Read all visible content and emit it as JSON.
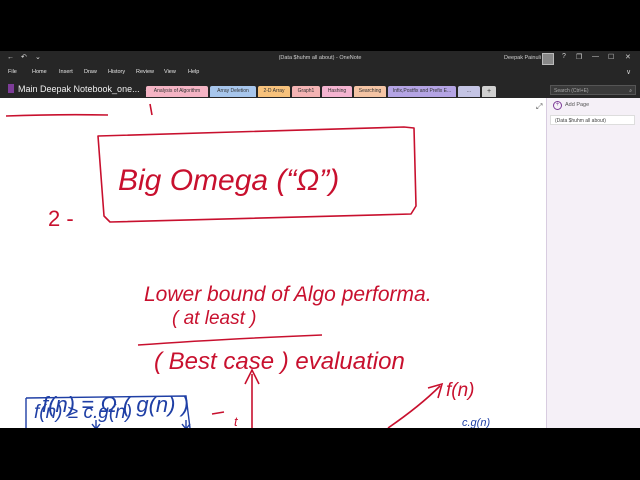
{
  "titlebar": {
    "title": "(Data $huhm all about)  -  OneNote",
    "user": "Deepak Painuli",
    "back_glyph": "←",
    "undo_glyph": "↶",
    "quick_glyph": "⌄",
    "help_glyph": "?",
    "restore_glyph": "❐",
    "minimize_glyph": "—",
    "maximize_glyph": "☐",
    "close_glyph": "✕"
  },
  "menu": {
    "items": [
      "File",
      "Home",
      "Insert",
      "Draw",
      "History",
      "Review",
      "View",
      "Help"
    ],
    "collapse_glyph": "∨"
  },
  "notebook": {
    "name": "Main Deepak Notebook_one...",
    "dropdown_glyph": "⌄"
  },
  "tabs": [
    {
      "label": "Analysis of Algorithm",
      "color": "#f4b4c4"
    },
    {
      "label": "Array Deletion",
      "color": "#a7c6ec"
    },
    {
      "label": "2-D Array",
      "color": "#f7c27c"
    },
    {
      "label": "Graph1",
      "color": "#f4b4b4"
    },
    {
      "label": "Hashing",
      "color": "#f4b4d0"
    },
    {
      "label": "Searching",
      "color": "#f4c4a4"
    },
    {
      "label": "Infix,Postfix and Prefix E...",
      "color": "#b4a4e4"
    },
    {
      "label": "...",
      "color": "#c4c4e4"
    },
    {
      "label": "+",
      "color": "#d0d0d0"
    }
  ],
  "search": {
    "placeholder": "Search (Ctrl+E)",
    "icon_glyph": "⌕"
  },
  "pages": {
    "add_label": "Add Page",
    "add_glyph": "+",
    "items": [
      "(Data $huhm all about)"
    ]
  },
  "canvas": {
    "expand_glyph": "⤢"
  },
  "ink": {
    "ink_color": "#c8102e",
    "blue_color": "#1f3fa5",
    "item_number": "2 -",
    "heading": "Big Omega (“Ω”)",
    "line1": "Lower bound of Algo performa.",
    "line2": "( at least )",
    "line3": "( Best case ) evaluation",
    "formula1": "f(n) = Ω ( g(n) )",
    "formula2": "f(n) ≥ c.g(n)",
    "graph_label": "f(n)",
    "time_label": "t",
    "small_label": "c.g(n)"
  }
}
